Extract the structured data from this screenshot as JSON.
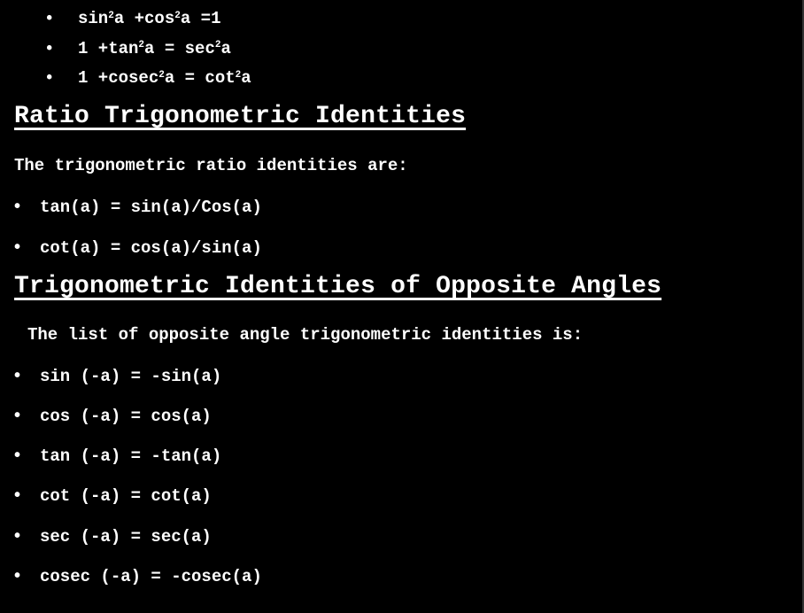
{
  "pythagorean_list": [
    {
      "base1": "sin",
      "exp1": "2",
      "rest1": "a +cos",
      "exp2": "2",
      "rest2": "a =1"
    },
    {
      "base1": "1 +tan",
      "exp1": "2",
      "rest1": "a = sec",
      "exp2": "2",
      "rest2": "a"
    },
    {
      "base1": "1 +cosec",
      "exp1": "2",
      "rest1": "a = cot",
      "exp2": "2",
      "rest2": "a"
    }
  ],
  "bullet_glyph": "•",
  "ratio_section": {
    "heading": "Ratio Trigonometric Identities",
    "intro": "The trigonometric ratio identities are:",
    "items": [
      "tan(a) = sin(a)/Cos(a)",
      "cot(a) = cos(a)/sin(a)"
    ]
  },
  "opposite_section": {
    "heading": "Trigonometric Identities of Opposite Angles",
    "intro": "The list of opposite angle trigonometric identities is:",
    "items": [
      "sin (-a) = -sin(a)",
      "cos (-a) = cos(a)",
      "tan (-a) = -tan(a)",
      "cot (-a) = cot(a)",
      "sec (-a) = sec(a)",
      "cosec (-a) = -cosec(a)"
    ]
  },
  "colors": {
    "background": "#000000",
    "text": "#ffffff"
  }
}
